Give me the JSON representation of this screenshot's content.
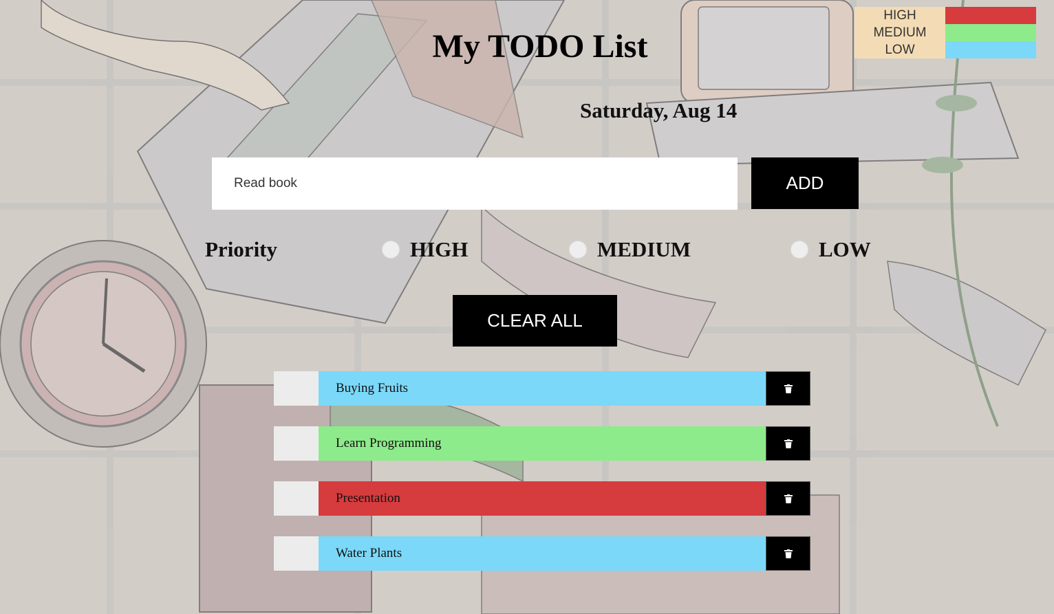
{
  "legend": [
    {
      "label": "HIGH",
      "color": "#d63b3e"
    },
    {
      "label": "MEDIUM",
      "color": "#8eeb8b"
    },
    {
      "label": "LOW",
      "color": "#7bd8f8"
    }
  ],
  "title": "My TODO List",
  "date": "Saturday, Aug 14",
  "input": {
    "value": "Read book"
  },
  "add_label": "ADD",
  "priority": {
    "label": "Priority",
    "options": [
      "HIGH",
      "MEDIUM",
      "LOW"
    ]
  },
  "clear_label": "CLEAR ALL",
  "todos": [
    {
      "text": "Buying Fruits",
      "priority": "LOW",
      "color": "#7bd8f8",
      "icon": "trash-icon"
    },
    {
      "text": "Learn Programming",
      "priority": "MEDIUM",
      "color": "#8eeb8b",
      "icon": "trash-icon"
    },
    {
      "text": "Presentation",
      "priority": "HIGH",
      "color": "#d63b3e",
      "icon": "trash-icon"
    },
    {
      "text": "Water Plants",
      "priority": "LOW",
      "color": "#7bd8f8",
      "icon": "trash-icon"
    }
  ]
}
